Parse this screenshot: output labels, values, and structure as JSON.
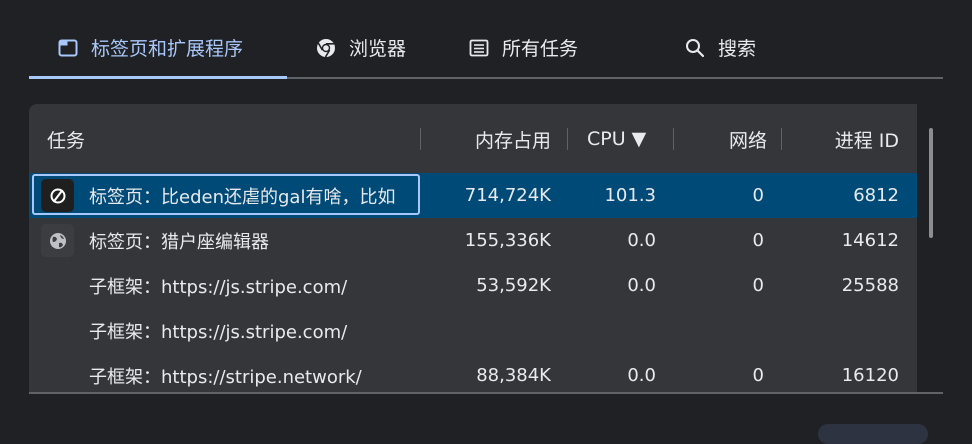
{
  "tabs": [
    {
      "label": "标签页和扩展程序",
      "icon": "tab-icon",
      "active": true
    },
    {
      "label": "浏览器",
      "icon": "chrome-icon",
      "active": false
    },
    {
      "label": "所有任务",
      "icon": "list-icon",
      "active": false
    },
    {
      "label": "搜索",
      "icon": "search-icon",
      "active": false
    }
  ],
  "table": {
    "columns": [
      "任务",
      "内存占用",
      "CPU ▼",
      "网络",
      "进程 ID"
    ],
    "rows": [
      {
        "task": "标签页：比eden还虐的gal有啥，比如",
        "memory": "714,724K",
        "cpu": "101.3",
        "network": "0",
        "pid": "6812",
        "icon": "blocked-icon",
        "selected": true
      },
      {
        "task": "标签页：猎户座编辑器",
        "memory": "155,336K",
        "cpu": "0.0",
        "network": "0",
        "pid": "14612",
        "icon": "globe-icon",
        "selected": false
      },
      {
        "task": "子框架：https://js.stripe.com/",
        "memory": "53,592K",
        "cpu": "0.0",
        "network": "0",
        "pid": "25588",
        "icon": "",
        "selected": false
      },
      {
        "task": "子框架：https://js.stripe.com/",
        "memory": "",
        "cpu": "",
        "network": "",
        "pid": "",
        "icon": "",
        "selected": false
      },
      {
        "task": "子框架：https://stripe.network/",
        "memory": "88,384K",
        "cpu": "0.0",
        "network": "0",
        "pid": "16120",
        "icon": "",
        "selected": false
      }
    ]
  },
  "colors": {
    "accent": "#a8c7fa",
    "selected_row": "#004a77",
    "panel": "#35363a",
    "background": "#202124"
  }
}
